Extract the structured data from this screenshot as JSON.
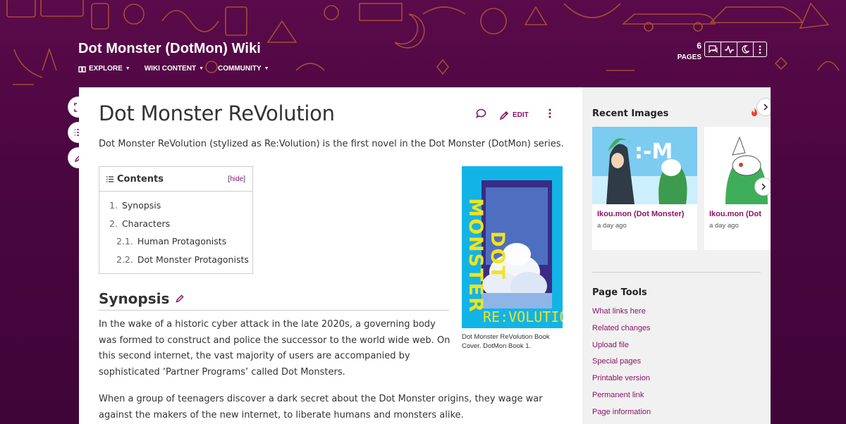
{
  "header": {
    "wiki_title": "Dot Monster (DotMon) Wiki",
    "nav": [
      {
        "label": "EXPLORE",
        "icon": "compass-icon"
      },
      {
        "label": "WIKI CONTENT"
      },
      {
        "label": "COMMUNITY"
      }
    ],
    "pages_count": "6",
    "pages_label": "PAGES",
    "tools": [
      "discussion-icon",
      "activity-icon",
      "theme-moon-icon",
      "more-icon"
    ]
  },
  "side_tools": [
    "fullscreen-icon",
    "toc-list-icon",
    "edit-icon"
  ],
  "article": {
    "title": "Dot Monster ReVolution",
    "edit_label": "EDIT",
    "intro": "Dot Monster ReVolution (stylized as Re:Volution) is the first novel in the Dot Monster (DotMon) series.",
    "toc": {
      "title": "Contents",
      "hide_open": "[",
      "hide_label": "hide",
      "hide_close": "]",
      "items": [
        {
          "num": "1.",
          "label": "Synopsis"
        },
        {
          "num": "2.",
          "label": "Characters"
        },
        {
          "num": "2.1.",
          "label": "Human Protagonists"
        },
        {
          "num": "2.2.",
          "label": "Dot Monster Protagonists"
        }
      ]
    },
    "figure": {
      "cover_title": "DOT MONSTER",
      "cover_subtitle": "RE:VOLUTION",
      "caption": "Dot Monster ReVolution Book Cover. DotMon Book 1."
    },
    "synopsis_heading": "Synopsis",
    "paragraphs": [
      "In the wake of a historic cyber attack in the late 2020s, a governing body was formed to construct and police the successor to the world wide web. On this second internet, the vast majority of users are accompanied by sophisticated ‘Partner Programs’ called Dot Monsters.",
      "When a group of teenagers discover a dark secret about the Dot Monster origins, they wage war against the makers of the new internet, to liberate humans and monsters alike."
    ]
  },
  "rail": {
    "recent_images_title": "Recent Images",
    "images": [
      {
        "name": "Ikou.mon (Dot Monster)",
        "time": "a day ago"
      },
      {
        "name": "Ikou.mon (Dot",
        "time": "a day ago"
      }
    ],
    "page_tools_title": "Page Tools",
    "page_tools": [
      "What links here",
      "Related changes",
      "Upload file",
      "Special pages",
      "Printable version",
      "Permanent link",
      "Page information"
    ]
  },
  "colors": {
    "accent": "#8a1365",
    "header_bg": "#4a0640",
    "doodle": "#c9702f",
    "cover_blue": "#12b4e6",
    "cover_yellow": "#f3e31c"
  }
}
